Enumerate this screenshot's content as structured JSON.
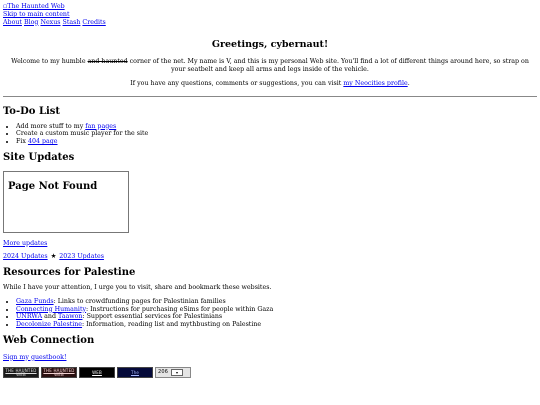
{
  "header": {
    "logo_alt": "The Haunted Web",
    "skip_link": "Skip to main content",
    "nav": [
      "About",
      "Blog",
      "Nexus",
      "Stash",
      "Credits"
    ]
  },
  "welcome": {
    "title": "Greetings, cybernaut!",
    "p1_start": "Welcome to my humble",
    "p1_strike": "and haunted",
    "p1_rest": "corner of the net. My name is V, and this is my personal Web site. You'll find a lot of different things around here, so strap on your seatbelt and keep all arms and legs inside of the vehicle.",
    "p2_start": "If you have any questions, comments or suggestions, you can visit",
    "p2_link": "my Neocities profile",
    "p2_end": "."
  },
  "todo": {
    "heading": "To-Do List",
    "item1_start": "Add more stuff to my",
    "item1_link": "fan pages",
    "item2": "Create a custom music player for the site",
    "item3_start": "Fix",
    "item3_link": "404 page"
  },
  "updates": {
    "heading": "Site Updates",
    "frame_title": "Page Not Found",
    "more_link": "More updates",
    "link_2024": "2024 Updates",
    "separator": "★",
    "link_2023": "2023 Updates"
  },
  "palestine": {
    "heading": "Resources for Palestine",
    "intro": "While I have your attention, I urge you to visit, share and bookmark these websites.",
    "items": [
      {
        "link": "Gaza Funds",
        "text": ": Links to crowdfunding pages for Palestinian families"
      },
      {
        "link": "Connecting Humanity",
        "text": ": Instructions for purchasing eSims for people within Gaza"
      },
      {
        "link": "UNRWA",
        "mid": "and",
        "link2": "Taawon",
        "text": ": Support essential services for Palestinians"
      },
      {
        "link": "Decolonize Palestine",
        "text": ": Information, reading list and mythbusting on Palestine"
      }
    ]
  },
  "connection": {
    "heading": "Web Connection",
    "guestbook_link": "Sign my guestbook!",
    "buttons": [
      "THE HAUNTED WEB",
      "THE HAUNTED WEB",
      "WEB",
      "The",
      "206"
    ]
  }
}
